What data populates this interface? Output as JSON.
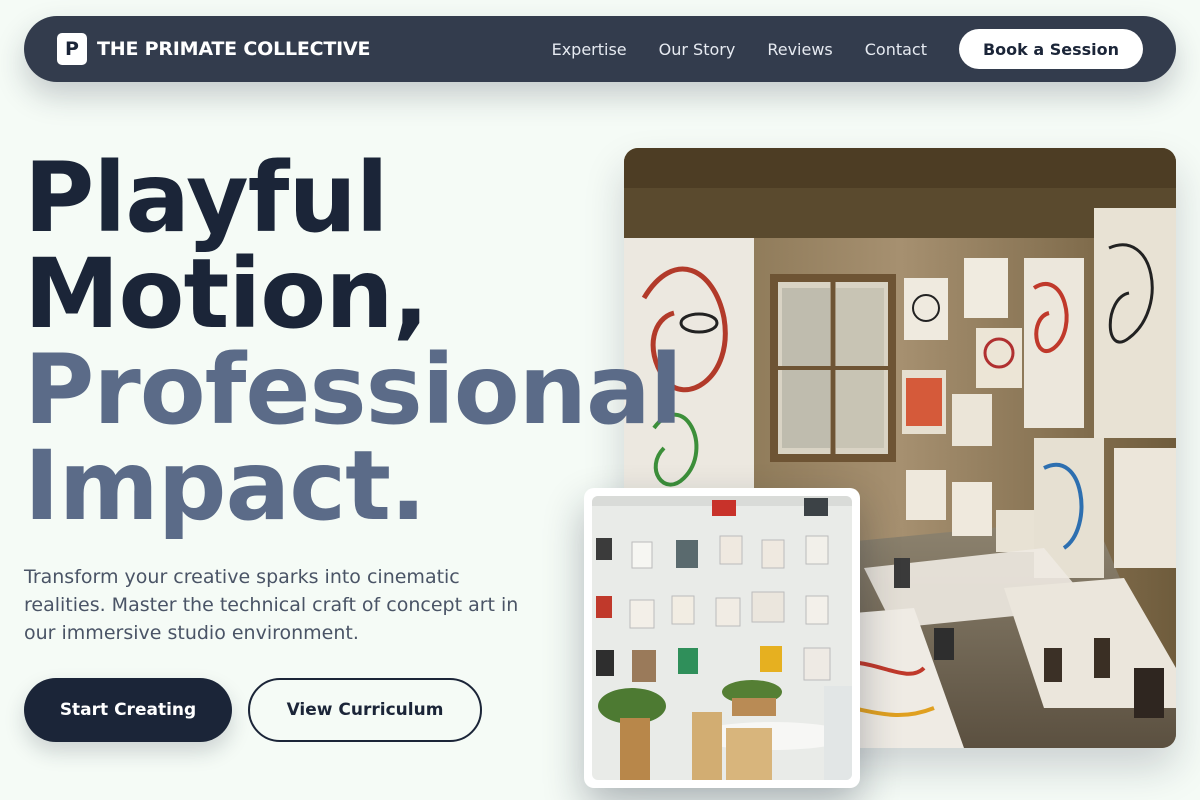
{
  "nav": {
    "logo_letter": "P",
    "brand": "THE PRIMATE COLLECTIVE",
    "links": [
      "Expertise",
      "Our Story",
      "Reviews",
      "Contact"
    ],
    "cta": "Book a Session"
  },
  "hero": {
    "headline_line1": "Playful",
    "headline_line2": "Motion,",
    "headline_line3": "Professional",
    "headline_line4": "Impact.",
    "subtitle": "Transform your creative sparks into cinematic realities. Master the technical craft of concept art in our immersive studio environment.",
    "primary_button": "Start Creating",
    "secondary_button": "View Curriculum"
  },
  "colors": {
    "nav_bg": "#333c4d",
    "text_dark": "#1b2538",
    "text_muted": "#5b6b88",
    "page_bg": "#f5fbf6"
  }
}
